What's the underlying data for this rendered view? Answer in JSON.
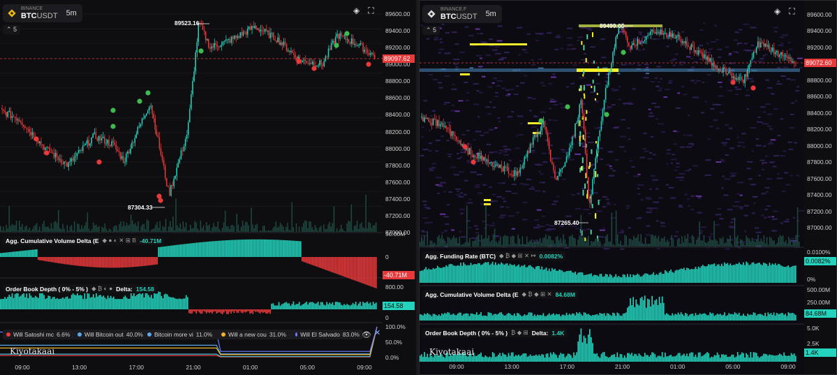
{
  "left": {
    "exchange": "BINANCE",
    "symbol_base": "BTC",
    "symbol_quote": "USDT",
    "timeframe": "5m",
    "collapse_label": "5",
    "price_axis": [
      "89600.00",
      "89400.00",
      "89200.00",
      "89000.00",
      "88800.00",
      "88600.00",
      "88400.00",
      "88200.00",
      "88000.00",
      "87800.00",
      "87600.00",
      "87400.00",
      "87200.00",
      "87000.00"
    ],
    "last_price": "89097.62",
    "high_annotation": "89523.16",
    "low_annotation": "87304.33",
    "cvd": {
      "title": "Agg. Cumulative Volume Delta (E",
      "value": "-40.71M",
      "axis_top": "50.00M",
      "axis_zero": "0",
      "tag": "-40.71M"
    },
    "obd": {
      "title": "Order Book Depth ( 0% - 5% )",
      "delta_label": "Delta:",
      "delta_value": "154.58",
      "axis_top": "800.00",
      "axis_zero": "0",
      "tag": "154.58"
    },
    "polymarket": {
      "axis": [
        "100.0%",
        "50.0%",
        "0.0%"
      ],
      "markets": [
        {
          "label": "Will Satoshi mc",
          "value": "6.6%",
          "color": "#e8393b"
        },
        {
          "label": "Will Bitcoin out",
          "value": "40.0%",
          "color": "#5aa8e6"
        },
        {
          "label": "Bitcoin more vi",
          "value": "11.0%",
          "color": "#5aa8e6"
        },
        {
          "label": "Will a new cou",
          "value": "31.0%",
          "color": "#f0b429"
        },
        {
          "label": "Will El Salvado",
          "value": "83.0%",
          "color": "#6b7cff"
        }
      ]
    },
    "watermark": "Kiyotakaai",
    "time_axis": [
      "09:00",
      "13:00",
      "17:00",
      "21:00",
      "01:00",
      "05:00",
      "09:00"
    ]
  },
  "right": {
    "exchange": "BINANCE.F",
    "symbol_base": "BTC",
    "symbol_quote": "USDT",
    "timeframe": "5m",
    "collapse_label": "5",
    "price_axis": [
      "89600.00",
      "89400.00",
      "89200.00",
      "89000.00",
      "88800.00",
      "88600.00",
      "88400.00",
      "88200.00",
      "88000.00",
      "87800.00",
      "87600.00",
      "87400.00",
      "87200.00",
      "87000.00"
    ],
    "last_price": "89072.60",
    "high_annotation": "89499.00",
    "low_annotation": "87265.40",
    "funding": {
      "title": "Agg. Funding Rate (BTC)",
      "value": "0.0082%",
      "axis": [
        "0.0100%",
        "0.0082%",
        "0%"
      ]
    },
    "cvd": {
      "title": "Agg. Cumulative Volume Delta (E",
      "value": "84.68M",
      "axis": [
        "500.00M",
        "250.00M",
        "84.68M"
      ]
    },
    "obd": {
      "title": "Order Book Depth ( 0% - 5% )",
      "delta_label": "Delta:",
      "delta_value": "1.4K",
      "axis": [
        "5.0K",
        "2.5K",
        "1.4K"
      ]
    },
    "watermark": "Kiyotakaai",
    "time_axis": [
      "09:00",
      "13:00",
      "17:00",
      "21:00",
      "01:00",
      "05:00",
      "09:00"
    ]
  },
  "colors": {
    "up": "#23d3bd",
    "down": "#e8393b",
    "background": "#0e0e10",
    "marker_green": "#3fb950",
    "marker_red": "#e8393b",
    "heat_yellow": "#f5f02a"
  }
}
